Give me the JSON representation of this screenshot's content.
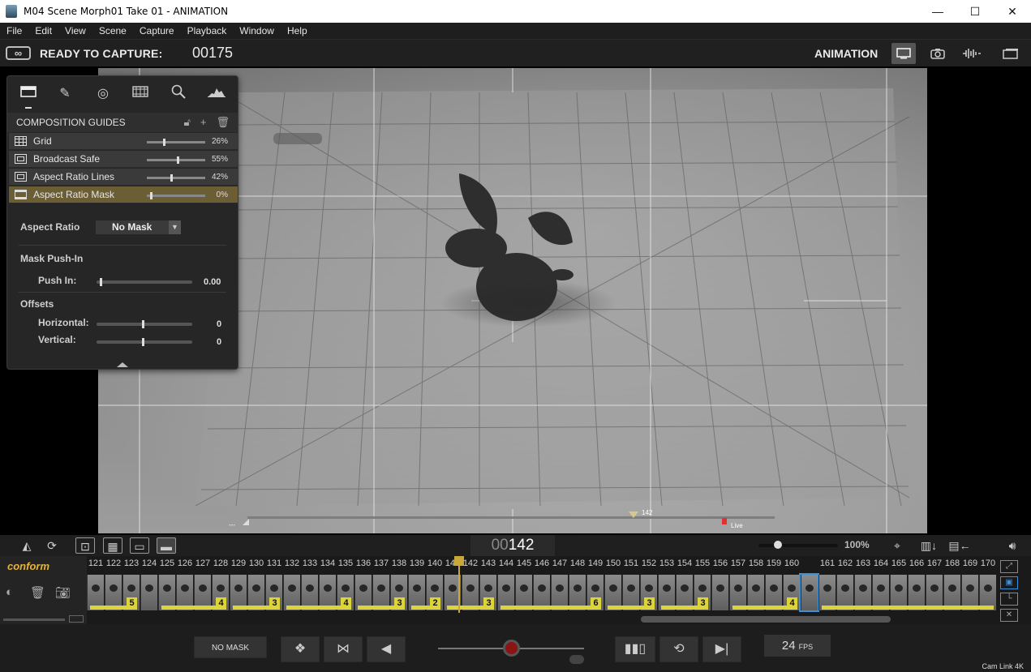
{
  "window": {
    "title": "M04  Scene Morph01  Take 01 - ANIMATION",
    "minimize": "—",
    "maximize": "☐",
    "close": "✕"
  },
  "menu": [
    "File",
    "Edit",
    "View",
    "Scene",
    "Capture",
    "Playback",
    "Window",
    "Help"
  ],
  "status": {
    "ready_label": "READY TO CAPTURE:",
    "capture_frame": "00175",
    "mode_label": "ANIMATION"
  },
  "viewer": {
    "scrub_start_label": "---",
    "scrub_marker_label": "142",
    "live_label": "Live"
  },
  "panel": {
    "header": "COMPOSITION GUIDES",
    "guides": [
      {
        "label": "Grid",
        "value": "26%",
        "level": 0.26
      },
      {
        "label": "Broadcast Safe",
        "value": "55%",
        "level": 0.55
      },
      {
        "label": "Aspect Ratio Lines",
        "value": "42%",
        "level": 0.42
      },
      {
        "label": "Aspect Ratio Mask",
        "value": "0%",
        "level": 0.0
      }
    ],
    "aspect_ratio_label": "Aspect Ratio",
    "aspect_ratio_value": "No Mask",
    "mask_pushin_label": "Mask Push-In",
    "push_in_label": "Push In:",
    "push_in_value": "0.00",
    "offsets_label": "Offsets",
    "horizontal_label": "Horizontal:",
    "horizontal_value": "0",
    "vertical_label": "Vertical:",
    "vertical_value": "0"
  },
  "timeline": {
    "frame_counter_prefix": "00",
    "frame_counter_value": "142",
    "zoom": "100%",
    "conform_label": "conform",
    "frame_numbers": [
      "121",
      "122",
      "123",
      "124",
      "125",
      "126",
      "127",
      "128",
      "129",
      "130",
      "131",
      "132",
      "133",
      "134",
      "135",
      "136",
      "137",
      "138",
      "139",
      "140",
      "141",
      "142",
      "143",
      "144",
      "145",
      "146",
      "147",
      "148",
      "149",
      "150",
      "151",
      "152",
      "153",
      "154",
      "155",
      "156",
      "157",
      "158",
      "159",
      "160",
      "",
      "161",
      "162",
      "163",
      "164",
      "165",
      "166",
      "167",
      "168",
      "169",
      "170"
    ],
    "holds": [
      "5",
      "4",
      "3",
      "4",
      "3",
      "2",
      "3",
      "6",
      "3",
      "3",
      "4"
    ]
  },
  "transport": {
    "no_mask_label": "NO MASK",
    "fps_value": "24",
    "fps_unit": "FPS",
    "camera_label": "Cam Link 4K"
  }
}
